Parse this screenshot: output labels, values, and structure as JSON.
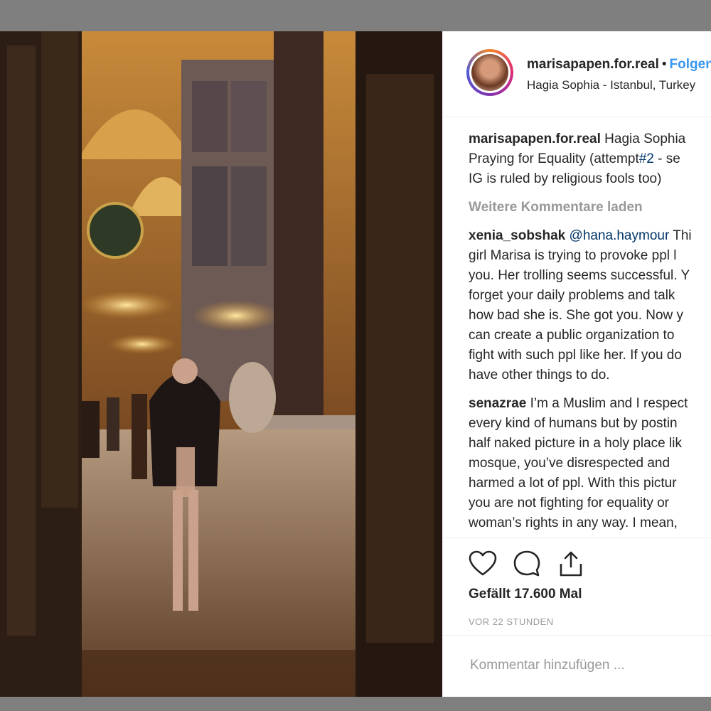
{
  "header": {
    "username": "marisapapen.for.real",
    "separator": "•",
    "follow_label": "Folgen",
    "location": "Hagia Sophia - Istanbul, Turkey"
  },
  "caption": {
    "user": "marisapapen.for.real",
    "text_1": "Hagia Sophia",
    "line_2a": "Praying for Equality (attempt",
    "hashtag": "#2",
    "line_2b": " - se",
    "line_3": "IG is ruled by religious fools too)"
  },
  "load_more_label": "Weitere Kommentare laden",
  "comments": [
    {
      "user": "xenia_sobshak",
      "mention": "@hana.haymour",
      "first_tail": " Thi",
      "lines": [
        "girl Marisa is trying to provoke ppl l",
        "you. Her trolling seems successful. Y",
        "forget your daily problems and talk",
        "how bad she is. She got you. Now y",
        "can create a public organization to",
        "fight with such ppl like her. If you do",
        "have other things to do."
      ]
    },
    {
      "user": "senazrae",
      "first_tail": " I’m a Muslim and I respect",
      "lines": [
        "every kind of humans but by postin",
        "half naked picture in a holy place lik",
        "mosque, you’ve disrespected and",
        "harmed a lot of ppl. With this pictur",
        "you are not fighting for equality or",
        "woman’s rights in any way. I mean,"
      ]
    }
  ],
  "actions": {
    "likes_label": "Gefällt 17.600 Mal",
    "timestamp": "VOR 22 STUNDEN",
    "comment_placeholder": "Kommentar hinzufügen ..."
  },
  "icons": [
    "heart-icon",
    "comment-icon",
    "share-icon"
  ],
  "colors": {
    "link": "#3897f0",
    "mention": "#003569",
    "muted": "#999999",
    "text": "#262626"
  }
}
